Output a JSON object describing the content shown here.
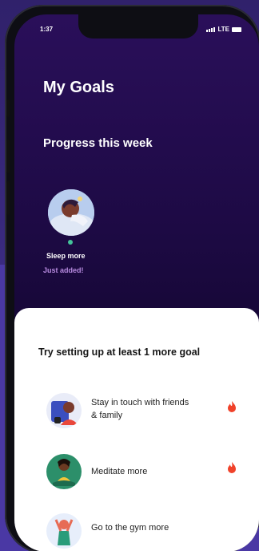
{
  "status": {
    "time": "1:37",
    "network": "LTE"
  },
  "header": {
    "title": "My Goals"
  },
  "progress": {
    "heading": "Progress this week",
    "goal": {
      "name": "Sleep more",
      "status": "Just added!"
    }
  },
  "suggestions": {
    "heading": "Try setting up at least 1 more goal",
    "items": [
      {
        "label_line1": "Stay in touch with friends",
        "label_line2": "& family",
        "popular": true
      },
      {
        "label_line1": "Meditate more",
        "label_line2": "",
        "popular": true
      },
      {
        "label_line1": "Go to the gym more",
        "label_line2": "",
        "popular": false
      }
    ]
  },
  "colors": {
    "accent_purple": "#b88be0",
    "flame": "#f0422a",
    "dot_green": "#44c49a"
  }
}
